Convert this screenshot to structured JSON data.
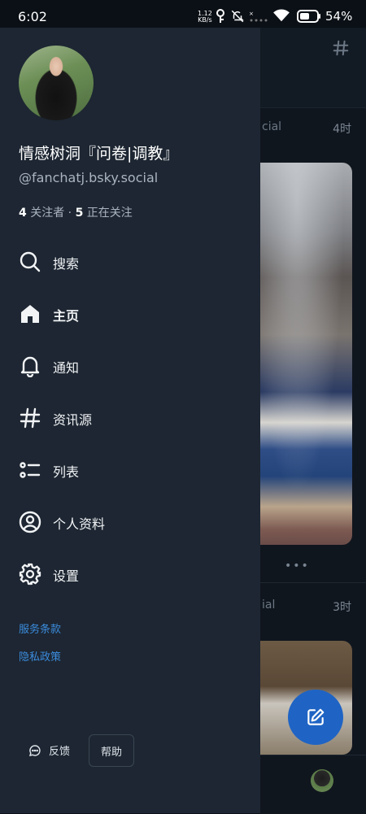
{
  "status_bar": {
    "time": "6:02",
    "net_speed_value": "1.12",
    "net_speed_unit": "KB/s",
    "battery": "54%",
    "icons": [
      "key-icon",
      "mute-bell-icon",
      "wifi-icon",
      "battery-icon"
    ]
  },
  "drawer": {
    "display_name": "情感树洞『问卷|调教』",
    "handle": "@fanchatj.bsky.social",
    "followers_count": "4",
    "followers_label": "关注者",
    "separator": " · ",
    "following_count": "5",
    "following_label": "正在关注",
    "nav": [
      {
        "label": "搜索",
        "icon": "search-icon"
      },
      {
        "label": "主页",
        "icon": "home-icon"
      },
      {
        "label": "通知",
        "icon": "bell-icon"
      },
      {
        "label": "资讯源",
        "icon": "hashtag-icon"
      },
      {
        "label": "列表",
        "icon": "list-icon"
      },
      {
        "label": "个人资料",
        "icon": "profile-icon"
      },
      {
        "label": "设置",
        "icon": "settings-icon"
      }
    ],
    "links": {
      "terms": "服务条款",
      "privacy": "隐私政策"
    },
    "feedback_label": "反馈",
    "help_label": "帮助"
  },
  "background_feed": {
    "post1_name_fragment": "cial",
    "post1_time": "4时",
    "post2_name_fragment": "ial",
    "post2_time": "3时",
    "more_dots": "•••"
  },
  "colors": {
    "drawer_bg": "#1d2632",
    "accent_link": "#3b8bdc",
    "fab": "#1f64c4"
  }
}
